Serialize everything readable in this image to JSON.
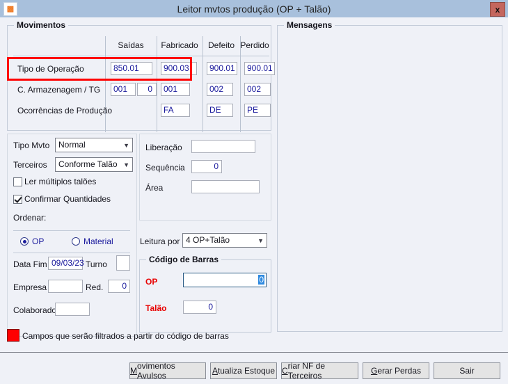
{
  "window": {
    "title": "Leitor mvtos produção (OP + Talão)",
    "icon": "app-icon",
    "close_label": "x",
    "titlebar_color": "#a8c0dc",
    "close_color": "#c4665e"
  },
  "movimentos": {
    "legend": "Movimentos",
    "columns": [
      "Saídas",
      "Fabricado",
      "Defeito",
      "Perdido"
    ],
    "rows": [
      {
        "label": "Tipo de Operação",
        "cells": [
          "850.01",
          "900.03",
          "900.01",
          "900.01"
        ],
        "highlighted": true
      },
      {
        "label": "C. Armazenagem / TG",
        "cells": [
          "001",
          "001",
          "002",
          "002"
        ],
        "extra": "0"
      },
      {
        "label": "Ocorrências de Produção",
        "cells": [
          "",
          "FA",
          "DE",
          "PE"
        ]
      }
    ]
  },
  "mensagens": {
    "legend": "Mensagens",
    "body": ""
  },
  "left_panel": {
    "tipo_mvto": {
      "label": "Tipo Mvto",
      "value": "Normal"
    },
    "terceiros": {
      "label": "Terceiros",
      "value": "Conforme Talão"
    },
    "ler_multiplos": {
      "label": "Ler múltiplos talões",
      "checked": false
    },
    "confirmar_qtd": {
      "label": "Confirmar Quantidades",
      "checked": true
    },
    "ordenar": {
      "label": "Ordenar:",
      "options": [
        {
          "label": "OP",
          "selected": true
        },
        {
          "label": "Material",
          "selected": false
        }
      ]
    },
    "data_fim": {
      "label": "Data Fim",
      "value": "09/03/23"
    },
    "turno": {
      "label": "Turno",
      "value": ""
    },
    "empresa": {
      "label": "Empresa",
      "value": ""
    },
    "red": {
      "label": "Red.",
      "value": "0"
    },
    "colaborador": {
      "label": "Colaborador",
      "value": ""
    }
  },
  "right_panel": {
    "liberacao": {
      "label": "Liberação",
      "value": ""
    },
    "sequencia": {
      "label": "Sequência",
      "value": "0"
    },
    "area": {
      "label": "Área",
      "value": ""
    },
    "leitura_por": {
      "label": "Leitura por",
      "value": "4 OP+Talão"
    },
    "codigo_barras": {
      "legend": "Código de Barras",
      "op": {
        "label": "OP",
        "value": "0"
      },
      "talao": {
        "label": "Talão",
        "value": "0"
      }
    }
  },
  "legend_note": {
    "text": "Campos que serão filtrados a partir do código de barras",
    "color": "#ff0000"
  },
  "buttons": [
    {
      "accel": "M",
      "rest": "ovimentos Avulsos",
      "name": "movimentos-avulsos"
    },
    {
      "accel": "A",
      "rest": "tualiza Estoque",
      "name": "atualiza-estoque"
    },
    {
      "accel": "C",
      "rest": "riar NF de Terceiros",
      "name": "criar-nf-terceiros"
    },
    {
      "accel": "G",
      "rest": "erar Perdas",
      "name": "gerar-perdas"
    },
    {
      "accel": "",
      "rest": "Sair",
      "name": "sair"
    }
  ]
}
